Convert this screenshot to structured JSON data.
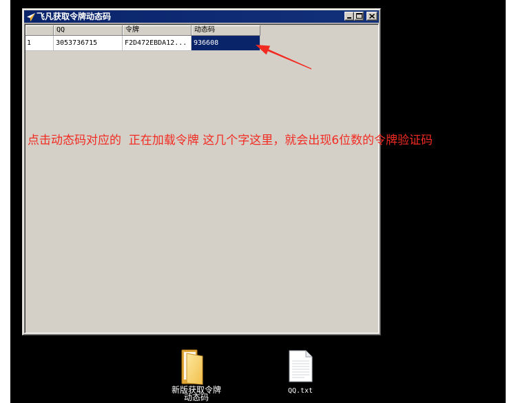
{
  "window": {
    "title": "飞凡获取令牌动态码",
    "app_icon": "paper-plane-icon",
    "controls": {
      "minimize": "minimize-icon",
      "maximize": "maximize-icon",
      "close": "close-icon"
    }
  },
  "grid": {
    "columns": [
      "QQ",
      "令牌",
      "动态码"
    ],
    "rows": [
      {
        "index": "1",
        "qq": "3053736715",
        "token": "F2D472EBDA12...",
        "code": "936608"
      }
    ],
    "selected_cell": {
      "row": 0,
      "column": 3
    }
  },
  "annotation": {
    "text": "点击动态码对应的  正在加载令牌 这几个字这里，就会出现6位数的令牌验证码",
    "color": "#f22b22",
    "arrow": "red-arrow-icon"
  },
  "desktop": {
    "icons": [
      {
        "label": "新版获取令牌动态码",
        "icon": "folder-icon"
      },
      {
        "label": "QQ.txt",
        "icon": "text-file-icon"
      }
    ]
  },
  "colors": {
    "desktop": "#000000",
    "window_face": "#d4d0c8",
    "title_bar": "#0a246a",
    "selection": "#0a246a",
    "selection_text": "#ffffff"
  }
}
